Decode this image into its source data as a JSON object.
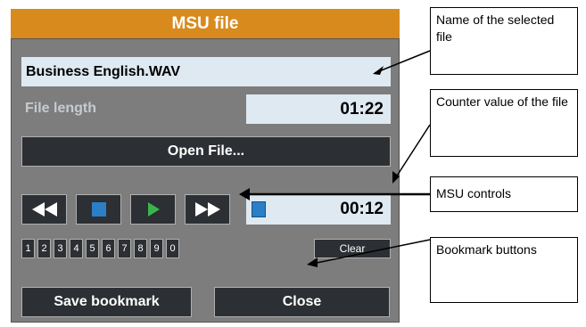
{
  "panel": {
    "title": "MSU file",
    "file_name": "Business English.WAV",
    "file_length_label": "File length",
    "file_length_value": "01:22",
    "open_label": "Open File...",
    "controls": [
      {
        "name": "rewind",
        "icon": "rewind-icon",
        "color": "#ffffff"
      },
      {
        "name": "stop",
        "icon": "stop-icon",
        "color": "#2a7fc6"
      },
      {
        "name": "play",
        "icon": "play-icon",
        "color": "#39b64a"
      },
      {
        "name": "fast-forward",
        "icon": "fast-forward-icon",
        "color": "#ffffff"
      }
    ],
    "counter_value": "00:12",
    "bookmarks": [
      "1",
      "2",
      "3",
      "4",
      "5",
      "6",
      "7",
      "8",
      "9",
      "0"
    ],
    "clear_label": "Clear",
    "save_label": "Save bookmark",
    "close_label": "Close"
  },
  "callouts": {
    "name": "Name of the selected file",
    "counter": "Counter value of the file",
    "controls": "MSU controls",
    "bookmarks": "Bookmark buttons"
  },
  "colors": {
    "title_bar": "#d98a1c",
    "panel_bg": "#7d7d7d",
    "field_bg": "#dfe9f2",
    "button_bg": "#2c2f33"
  }
}
